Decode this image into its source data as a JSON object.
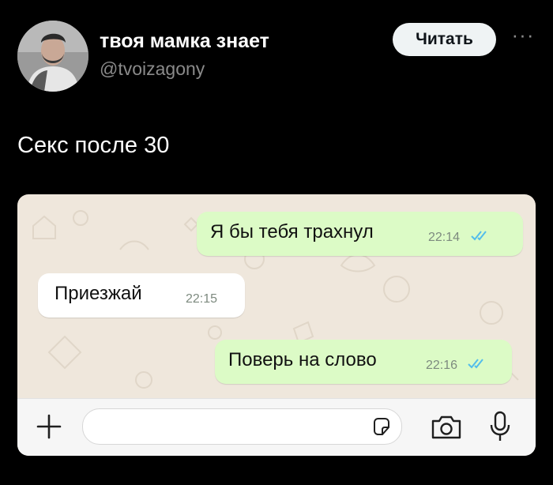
{
  "tweet": {
    "author_name": "твоя мамка знает",
    "author_handle": "@tvoizagony",
    "follow_label": "Читать",
    "more_label": "···",
    "text": "Секс после 30"
  },
  "chat": {
    "messages": [
      {
        "direction": "outgoing",
        "text": "Я бы тебя трахнул",
        "time": "22:14",
        "read": true
      },
      {
        "direction": "incoming",
        "text": "Приезжай",
        "time": "22:15"
      },
      {
        "direction": "outgoing",
        "text": "Поверь на слово",
        "time": "22:16",
        "read": true
      }
    ],
    "input": {
      "placeholder": ""
    },
    "colors": {
      "background": "#efe7dc",
      "outgoing_bubble": "#dcfbc6",
      "incoming_bubble": "#ffffff",
      "read_ticks": "#53bdeb"
    }
  }
}
